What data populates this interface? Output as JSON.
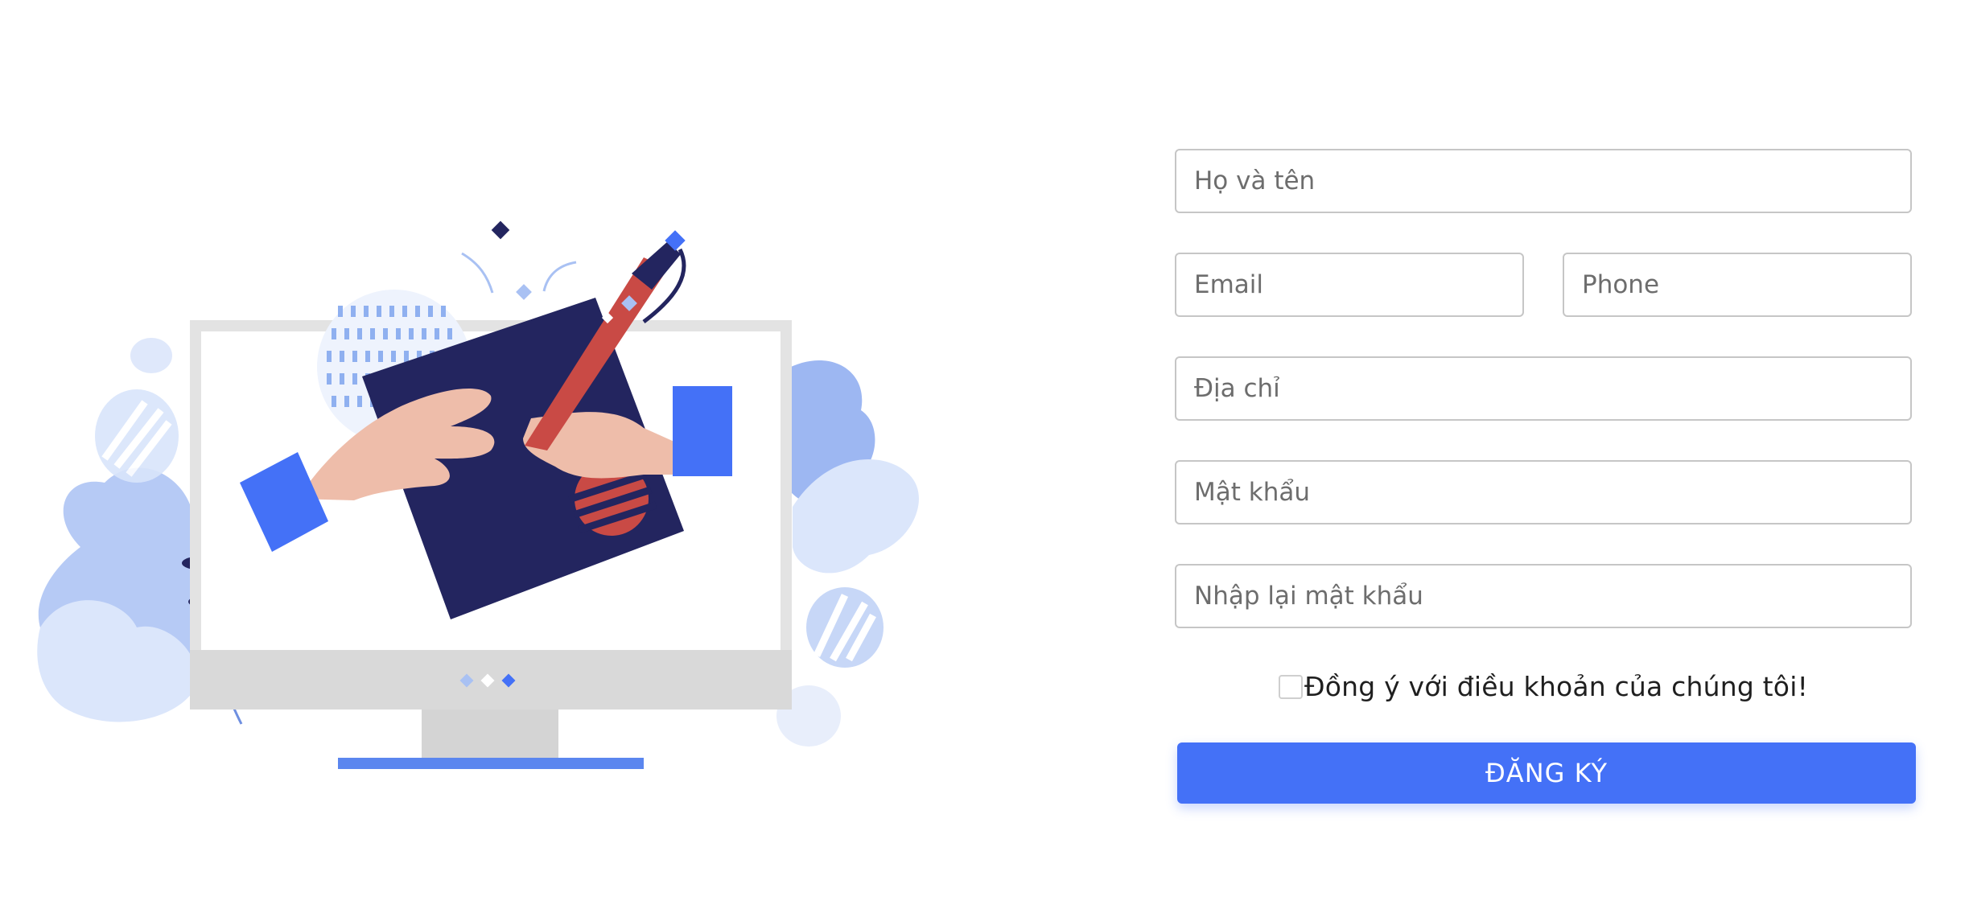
{
  "form": {
    "fullname": {
      "placeholder": "Họ và tên",
      "value": ""
    },
    "email": {
      "placeholder": "Email",
      "value": ""
    },
    "phone": {
      "placeholder": "Phone",
      "value": ""
    },
    "address": {
      "placeholder": "Địa chỉ",
      "value": ""
    },
    "password": {
      "placeholder": "Mật khẩu",
      "value": ""
    },
    "confirm_password": {
      "placeholder": "Nhập lại mật khẩu",
      "value": ""
    },
    "agree_label": "Đồng ý với điều khoản của chúng tôi!",
    "agree_checked": false,
    "submit_label": "ĐĂNG KÝ"
  },
  "colors": {
    "accent": "#4471f7",
    "navy": "#23255f",
    "coral": "#c94a45",
    "skin": "#eebdaa",
    "leaf": "#9db7f2"
  },
  "illustration": {
    "icon": "monitor-drawing-illustration"
  }
}
